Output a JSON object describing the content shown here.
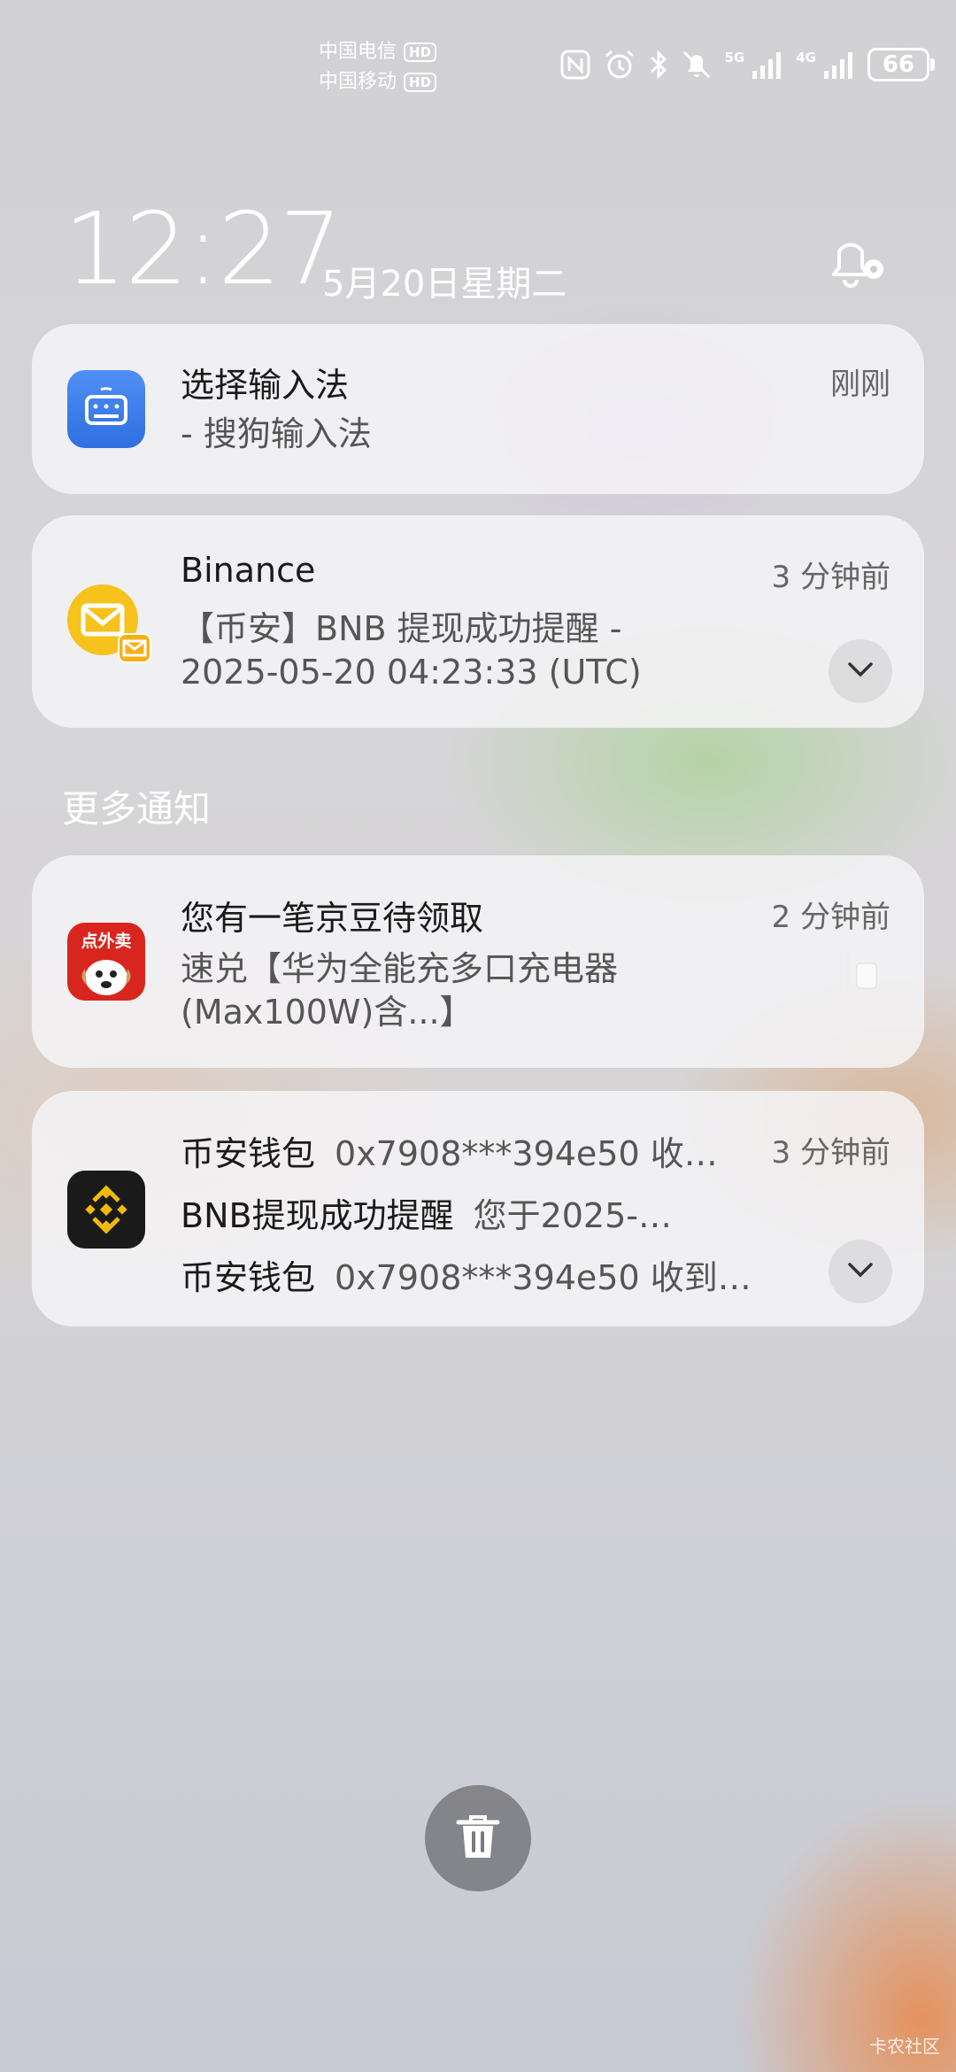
{
  "status_bar": {
    "carrier1": "中国电信",
    "carrier2": "中国移动",
    "hd_label": "HD",
    "net1": "5G",
    "net2": "4G",
    "battery": "66"
  },
  "lockscreen": {
    "time": "12:27",
    "date": "5月20日星期二"
  },
  "notifications": [
    {
      "app_icon": "keyboard-icon",
      "title": "选择输入法",
      "time": "刚刚",
      "body": "- 搜狗输入法"
    },
    {
      "app_icon": "mail-icon",
      "title": "Binance",
      "time": "3 分钟前",
      "body_line1": "【币安】BNB 提现成功提醒 -",
      "body_line2": "2025-05-20 04:23:33 (UTC)"
    }
  ],
  "more_section": {
    "label": "更多通知",
    "items": [
      {
        "app_icon": "dianwaimai-icon",
        "app_icon_text": "点外卖",
        "title": "您有一笔京豆待领取",
        "time": "2 分钟前",
        "body_line1": "速兑【华为全能充多口充电器",
        "body_line2": "(Max100W)含...】"
      },
      {
        "app_icon": "binance-logo-icon",
        "time": "3 分钟前",
        "lines": [
          {
            "title": "币安钱包",
            "text": "0x7908***394e50 收…"
          },
          {
            "title": "BNB提现成功提醒",
            "text": "您于2025-…"
          },
          {
            "title": "币安钱包",
            "text": "0x7908***394e50 收到…"
          }
        ]
      }
    ]
  },
  "watermark": "卡农社区"
}
